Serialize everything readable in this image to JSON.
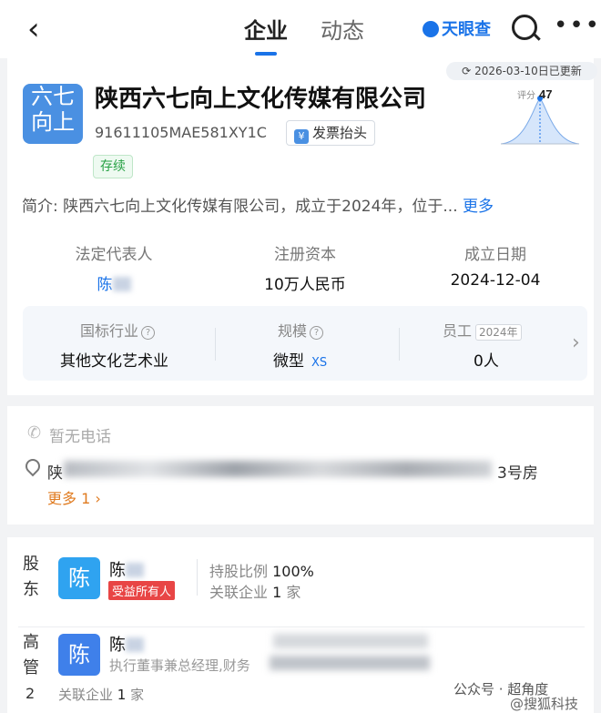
{
  "header": {
    "back_icon": "chevron-left-icon",
    "tabs": [
      "企业",
      "动态"
    ],
    "brand": "天眼查",
    "colors": {
      "accent": "#1a73e8"
    }
  },
  "company": {
    "update_badge": "2026-03-10日已更新",
    "logo_lines": [
      "六七",
      "向上"
    ],
    "name": "陕西六七向上文化传媒有限公司",
    "credit_code": "91611105MAE581XY1C",
    "invoice_label": "发票抬头",
    "status": "存续",
    "score_label": "评分",
    "score_value": "47",
    "intro_prefix": "简介:",
    "intro_text": "陕西六七向上文化传媒有限公司，成立于2024年，位于...",
    "intro_more": "更多",
    "legal_rep_label": "法定代表人",
    "legal_rep_value": "陈",
    "capital_label": "注册资本",
    "capital_value": "10万人民币",
    "founded_label": "成立日期",
    "founded_value": "2024-12-04",
    "industry_label": "国标行业",
    "industry_value": "其他文化艺术业",
    "scale_label": "规模",
    "scale_value": "微型",
    "scale_tag": "XS",
    "employees_label": "员工",
    "employees_year": "2024年",
    "employees_value": "0人"
  },
  "contact": {
    "phone_text": "暂无电话",
    "address_start": "陕",
    "address_end": "3号房",
    "more_text": "更多 1"
  },
  "shareholder": {
    "side_label": [
      "股",
      "东"
    ],
    "avatar_char": "陈",
    "name": "陈",
    "tag": "受益所有人",
    "ratio_label": "持股比例",
    "ratio_value": "100%",
    "related_label": "关联企业",
    "related_value": "1",
    "related_unit": "家"
  },
  "executive": {
    "side_label": [
      "高",
      "管"
    ],
    "count": "2",
    "avatar_char": "陈",
    "name": "陈",
    "role": "执行董事兼总经理,财务",
    "related_label": "关联企业",
    "related_value": "1",
    "related_unit": "家"
  },
  "watermarks": {
    "gzh": "公众号 · 超角度",
    "sohu": "@搜狐科技"
  }
}
